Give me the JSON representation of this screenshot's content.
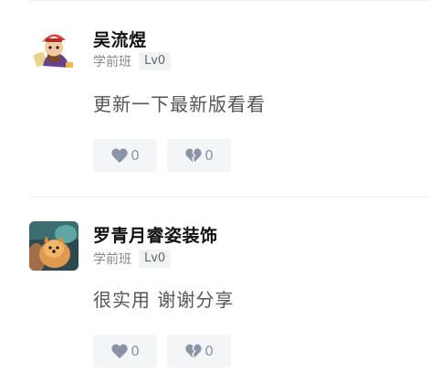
{
  "comments": [
    {
      "author": "吴流煜",
      "class_label": "学前班",
      "level": "Lv0",
      "content": "更新一下最新版看看",
      "like_count": "0",
      "dislike_count": "0",
      "avatar_icon": "cartoon-character-avatar"
    },
    {
      "author": "罗青月睿姿装饰",
      "class_label": "学前班",
      "level": "Lv0",
      "content": "很实用 谢谢分享",
      "like_count": "0",
      "dislike_count": "0",
      "avatar_icon": "pomeranian-dog-photo-avatar"
    }
  ],
  "colors": {
    "vote_icon": "#8a94a6",
    "vote_bg": "#f3f5f7",
    "badge_bg": "#f1f2f4"
  }
}
